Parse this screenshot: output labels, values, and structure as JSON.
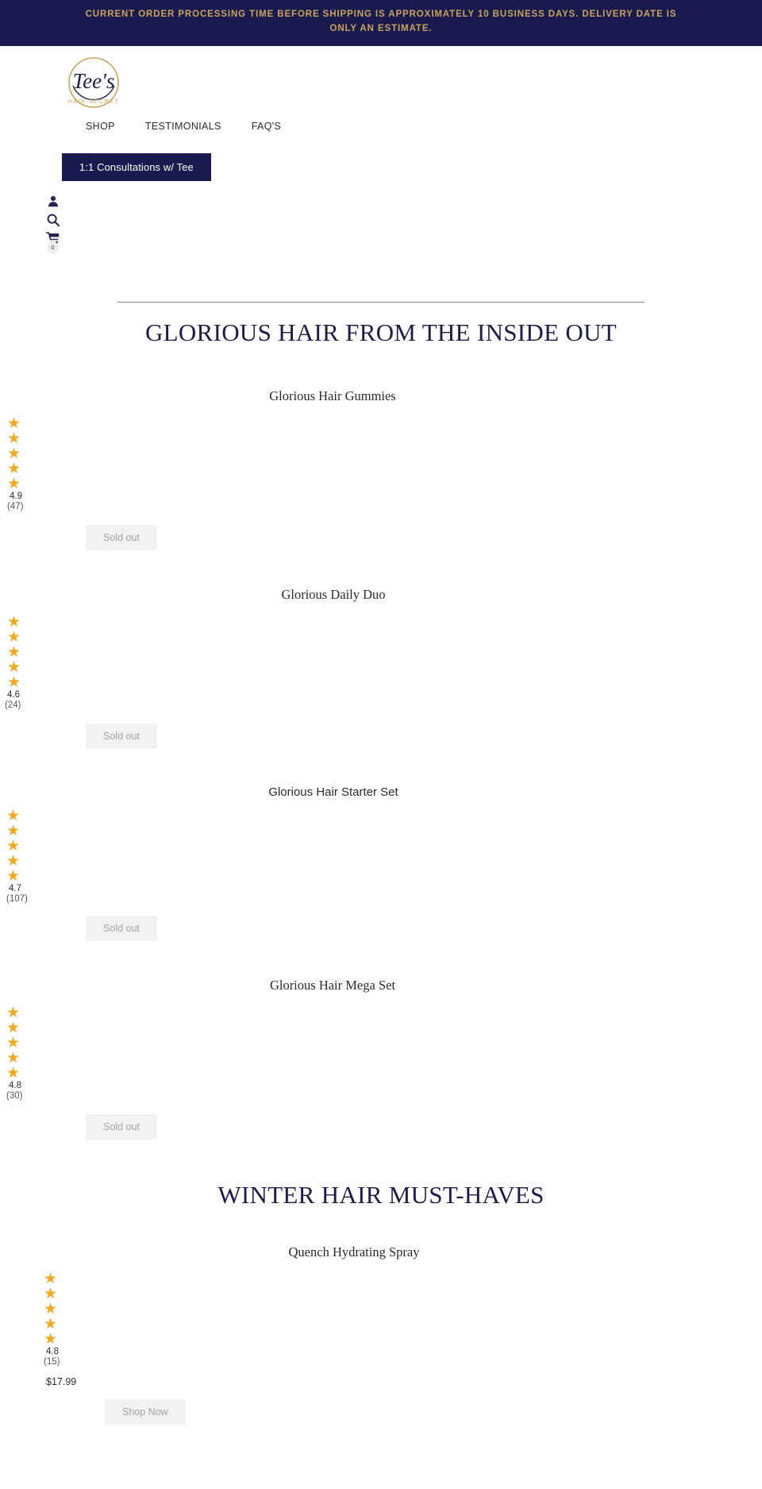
{
  "announcement": {
    "text": "CURRENT ORDER PROCESSING TIME BEFORE SHIPPING IS APPROXIMATELY 10 BUSINESS DAYS. DELIVERY DATE IS ONLY AN ESTIMATE.",
    "background_color": "#191a4e",
    "text_color": "#c9a45f"
  },
  "header": {
    "logo": {
      "brand_name": "Tee's",
      "tagline": "HAIR SECRET",
      "ring_color": "#c9a45f",
      "script_color": "#1c1d4a"
    },
    "nav": [
      {
        "label": "SHOP"
      },
      {
        "label": "TESTIMONIALS"
      },
      {
        "label": "FAQ'S"
      }
    ],
    "cta": {
      "label": "1:1 Consultations w/ Tee",
      "background_color": "#191a4e",
      "text_color": "#ffffff"
    },
    "icons": [
      {
        "name": "account-icon",
        "glyph": "person"
      },
      {
        "name": "search-icon",
        "glyph": "magnifier"
      },
      {
        "name": "cart-icon",
        "glyph": "cart",
        "badge": "0"
      }
    ]
  },
  "sections": [
    {
      "title": "GLORIOUS HAIR FROM THE INSIDE OUT",
      "has_rule": true,
      "products": [
        {
          "title": "Glorious Hair Gummies",
          "title_style": "serif",
          "rating": "4.9",
          "stars": 5,
          "review_count": "(47)",
          "price": "",
          "button_label": "Sold out"
        },
        {
          "title": "Glorious Daily Duo",
          "title_style": "serif",
          "rating": "4.6",
          "stars": 5,
          "review_count": "(24)",
          "price": "",
          "button_label": "Sold out"
        },
        {
          "title": "Glorious Hair Starter Set",
          "title_style": "sans",
          "rating": "4.7",
          "stars": 5,
          "review_count": "(107)",
          "price": "",
          "button_label": "Sold out"
        },
        {
          "title": "Glorious Hair Mega Set",
          "title_style": "serif",
          "rating": "4.8",
          "stars": 5,
          "review_count": "(30)",
          "price": "",
          "button_label": "Sold out"
        }
      ]
    },
    {
      "title": "WINTER HAIR MUST-HAVES",
      "has_rule": false,
      "products": [
        {
          "title": "Quench Hydrating Spray",
          "title_style": "serif",
          "rating": "4.8",
          "stars": 5,
          "review_count": "(15)",
          "price": "$17.99",
          "button_label": "Shop Now"
        }
      ]
    }
  ],
  "star_glyph": "★",
  "star_color": "#f2a922"
}
